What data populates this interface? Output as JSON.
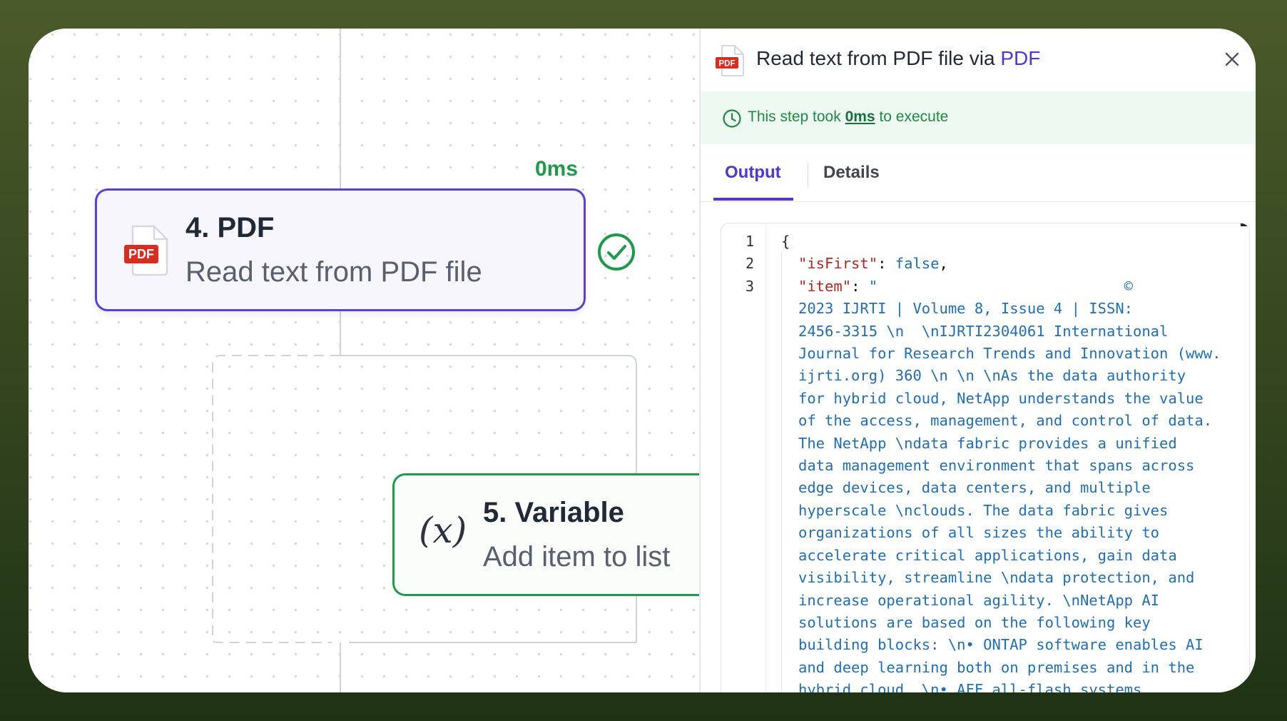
{
  "canvas": {
    "step_duration": "0ms",
    "pdf_node": {
      "title": "4. PDF",
      "subtitle": "Read text from PDF file",
      "icon": "pdf-file-icon",
      "badge": "PDF"
    },
    "variable_node": {
      "title": "5. Variable",
      "subtitle": "Add item to list",
      "icon_glyph": "(x)"
    }
  },
  "panel": {
    "title_prefix": "Read text from PDF file via ",
    "title_link": "PDF",
    "header_icon_badge": "PDF",
    "exec": {
      "prefix": "This step took ",
      "duration": "0ms",
      "suffix": " to execute"
    },
    "tabs": [
      {
        "label": "Output",
        "active": true
      },
      {
        "label": "Details",
        "active": false
      }
    ],
    "output": {
      "line_numbers": [
        "1",
        "2",
        "3"
      ],
      "open_brace": "{",
      "isFirst_key": "\"isFirst\"",
      "isFirst_value": "false",
      "item_key": "\"item\"",
      "item_value_lines": [
        "\"                            ©",
        "2023 IJRTI | Volume 8, Issue 4 | ISSN:",
        "2456-3315 \\n  \\nIJRTI2304061 International",
        "Journal for Research Trends and Innovation (www.",
        "ijrti.org) 360 \\n \\n \\nAs the data authority",
        "for hybrid cloud, NetApp understands the value",
        "of the access, management, and control of data.",
        "The NetApp \\ndata fabric provides a unified",
        "data management environment that spans across",
        "edge devices, data centers, and multiple",
        "hyperscale \\nclouds. The data fabric gives",
        "organizations of all sizes the ability to",
        "accelerate critical applications, gain data",
        "visibility, streamline \\ndata protection, and",
        "increase operational agility. \\nNetApp AI",
        "solutions are based on the following key",
        "building blocks: \\n• ONTAP software enables AI",
        "and deep learning both on premises and in the",
        "hybrid cloud. \\n• AFF all-flash systems"
      ]
    }
  },
  "colors": {
    "accent_purple": "#5b3fd6",
    "success_green": "#1f9a4a",
    "exec_bg": "#eef9f1",
    "pdf_red": "#d92d20"
  }
}
